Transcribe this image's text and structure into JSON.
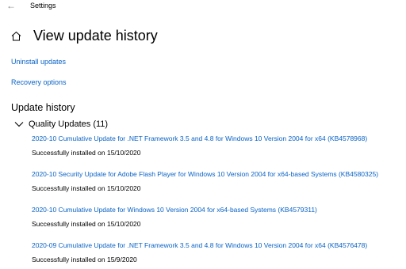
{
  "app": {
    "title": "Settings",
    "back_glyph": "←"
  },
  "page": {
    "title": "View update history",
    "icon": "home-icon"
  },
  "links": {
    "uninstall": "Uninstall updates",
    "recovery": "Recovery options"
  },
  "history": {
    "heading": "Update history",
    "group": {
      "label": "Quality Updates (11)",
      "expanded": true,
      "items": [
        {
          "title": "2020-10 Cumulative Update for .NET Framework 3.5 and 4.8 for Windows 10 Version 2004 for x64 (KB4578968)",
          "status": "Successfully installed on 15/10/2020"
        },
        {
          "title": "2020-10 Security Update for Adobe Flash Player for Windows 10 Version 2004 for x64-based Systems (KB4580325)",
          "status": "Successfully installed on 15/10/2020"
        },
        {
          "title": "2020-10 Cumulative Update for Windows 10 Version 2004 for x64-based Systems (KB4579311)",
          "status": "Successfully installed on 15/10/2020"
        },
        {
          "title": "2020-09 Cumulative Update for .NET Framework 3.5 and 4.8 for Windows 10 Version 2004 for x64 (KB4576478)",
          "status": "Successfully installed on 15/9/2020"
        }
      ]
    }
  },
  "colors": {
    "link": "#0a63c6",
    "text": "#000000",
    "background": "#ffffff"
  }
}
